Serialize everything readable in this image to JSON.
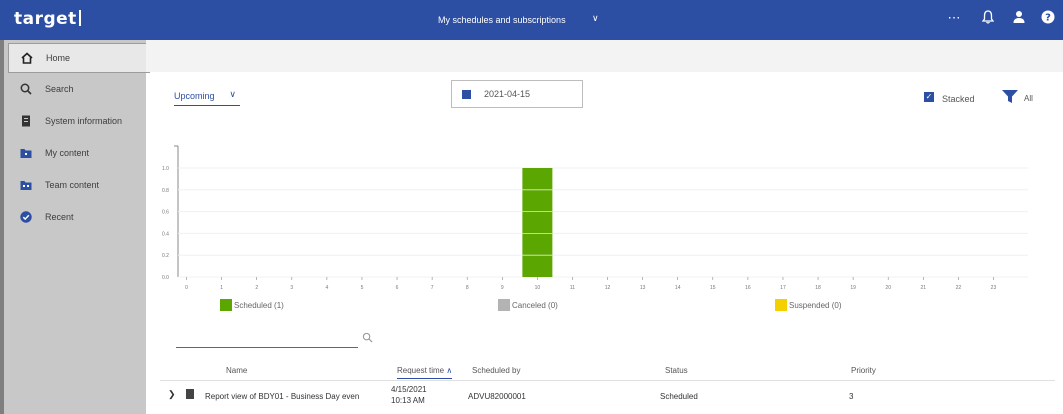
{
  "header": {
    "brand": "target",
    "title": "My schedules and subscriptions",
    "icons": [
      "more-icon",
      "bell-icon",
      "user-icon",
      "help-icon"
    ]
  },
  "sidebar": {
    "items": [
      {
        "label": "Home",
        "icon": "home-icon",
        "active": true
      },
      {
        "label": "Search",
        "icon": "search-icon"
      },
      {
        "label": "System information",
        "icon": "system-info-icon"
      },
      {
        "label": "My content",
        "icon": "folder-icon"
      },
      {
        "label": "Team content",
        "icon": "team-folder-icon"
      },
      {
        "label": "Recent",
        "icon": "recent-icon"
      }
    ]
  },
  "controls": {
    "view_select": "Upcoming",
    "date": "2021-04-15",
    "stacked_label": "Stacked",
    "stacked_checked": true,
    "filter_label": "All"
  },
  "colors": {
    "brand": "#2c4fa4",
    "scheduled": "#5ba600",
    "canceled": "#b3b3b3",
    "suspended": "#f5d000"
  },
  "chart_data": {
    "type": "bar",
    "stacked": true,
    "categories": [
      "0",
      "1",
      "2",
      "3",
      "4",
      "5",
      "6",
      "7",
      "8",
      "9",
      "10",
      "11",
      "12",
      "13",
      "14",
      "15",
      "16",
      "17",
      "18",
      "19",
      "20",
      "21",
      "22",
      "23"
    ],
    "ylim": [
      0,
      1.0
    ],
    "yticks": [
      "0.0",
      "0.2",
      "0.4",
      "0.6",
      "0.8",
      "1.0"
    ],
    "series": [
      {
        "name": "Scheduled",
        "legend": "Scheduled (1)",
        "values": [
          0,
          0,
          0,
          0,
          0,
          0,
          0,
          0,
          0,
          0,
          1,
          0,
          0,
          0,
          0,
          0,
          0,
          0,
          0,
          0,
          0,
          0,
          0,
          0
        ]
      },
      {
        "name": "Canceled",
        "legend": "Canceled (0)",
        "values": [
          0,
          0,
          0,
          0,
          0,
          0,
          0,
          0,
          0,
          0,
          0,
          0,
          0,
          0,
          0,
          0,
          0,
          0,
          0,
          0,
          0,
          0,
          0,
          0
        ]
      },
      {
        "name": "Suspended",
        "legend": "Suspended (0)",
        "values": [
          0,
          0,
          0,
          0,
          0,
          0,
          0,
          0,
          0,
          0,
          0,
          0,
          0,
          0,
          0,
          0,
          0,
          0,
          0,
          0,
          0,
          0,
          0,
          0
        ]
      }
    ]
  },
  "table": {
    "columns": [
      "Name",
      "Request time",
      "Scheduled by",
      "Status",
      "Priority"
    ],
    "rows": [
      {
        "name": "Report view of BDY01 - Business Day even",
        "request_date": "4/15/2021",
        "request_time": "10:13 AM",
        "scheduled_by": "ADVU82000001",
        "status": "Scheduled",
        "priority": "3"
      }
    ]
  }
}
